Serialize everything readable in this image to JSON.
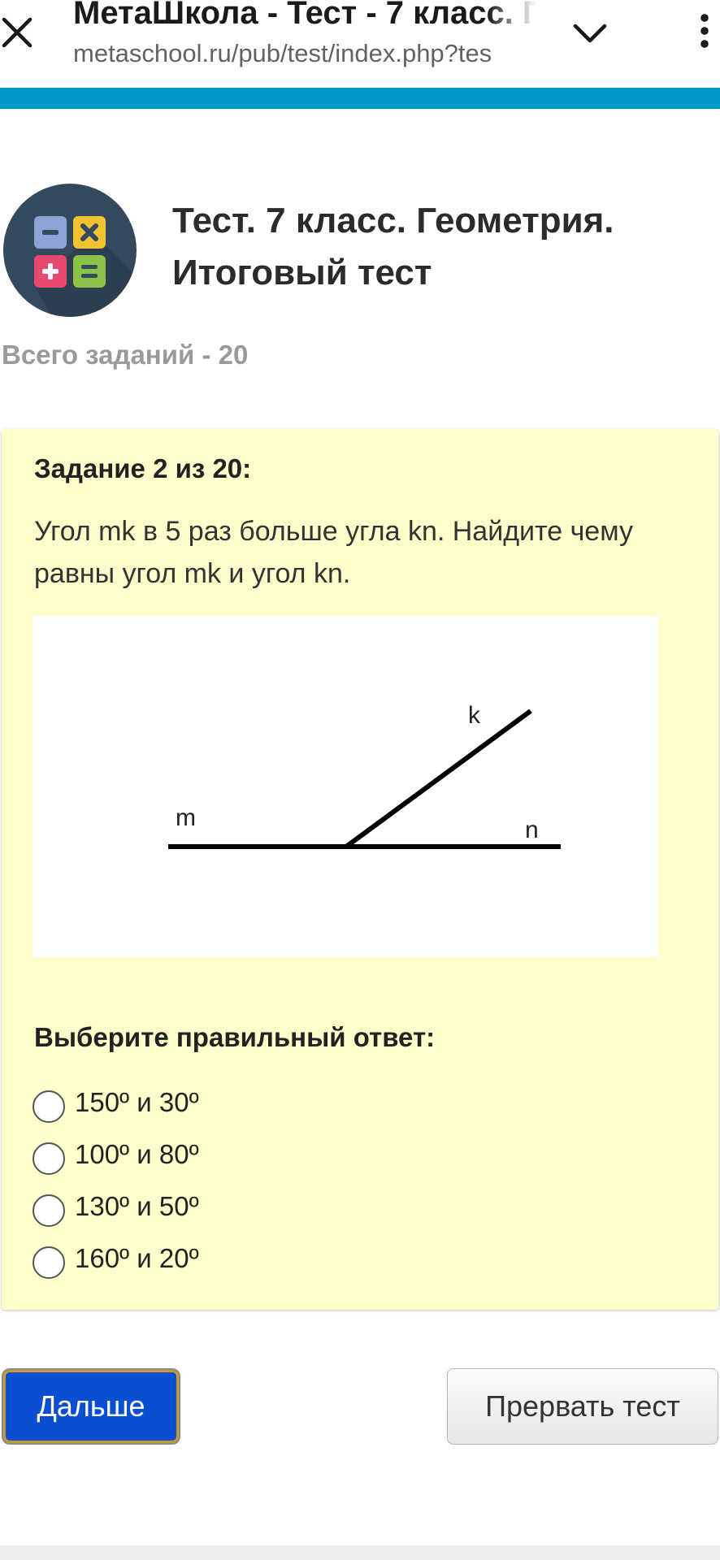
{
  "browser": {
    "tab_title": "МетаШкола - Тест - 7 класс. Г",
    "url": "metaschool.ru/pub/test/index.php?tes"
  },
  "header": {
    "title": "Тест. 7 класс. Геометрия. Итоговый тест",
    "task_count": "Всего заданий - 20"
  },
  "question": {
    "number_label": "Задание 2 из 20:",
    "text": "Угол mk в 5 раз больше угла kn. Найдите чему равны угол mk и угол kn.",
    "figure_labels": {
      "m": "m",
      "k": "k",
      "n": "n"
    },
    "answer_prompt": "Выберите правильный ответ:",
    "options": [
      {
        "label": "150º и 30º"
      },
      {
        "label": "100º и 80º"
      },
      {
        "label": "130º и 50º"
      },
      {
        "label": "160º и 20º"
      }
    ]
  },
  "buttons": {
    "next": "Дальше",
    "abort": "Прервать тест"
  },
  "colors": {
    "accent_stripe": "#0099cc",
    "card_background": "#ffffcc",
    "next_button": "#0a4fd1"
  },
  "icons": {
    "close": "close-icon",
    "chevron": "chevron-down-icon",
    "menu": "more-vert-icon",
    "logo": "calculator-logo"
  }
}
